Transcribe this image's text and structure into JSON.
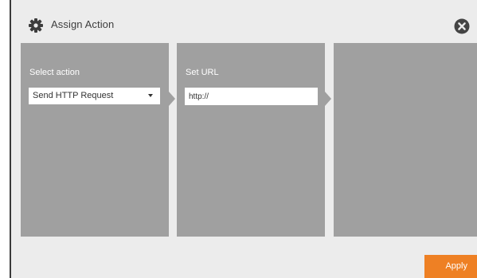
{
  "dialog": {
    "title": "Assign Action",
    "title_icon": "gear-icon",
    "close_icon": "close-icon"
  },
  "panels": {
    "action": {
      "label": "Select action",
      "select_value": "Send HTTP Request"
    },
    "url": {
      "label": "Set URL",
      "input_value": "http://"
    }
  },
  "footer": {
    "apply_label": "Apply"
  },
  "colors": {
    "accent": "#ee8024",
    "panel": "#a0a0a0",
    "background": "#ececec"
  }
}
